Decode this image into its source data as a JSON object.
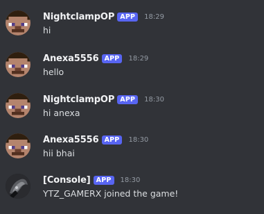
{
  "colors": {
    "background": "#313338",
    "app_badge": "#5865f2",
    "author": "#f2f3f5",
    "text": "#dbdee1",
    "timestamp": "#949ba4"
  },
  "messages": [
    {
      "author": "NightclampOP",
      "badge": "APP",
      "time": "18:29",
      "text": "hi",
      "avatar": "steve-avatar"
    },
    {
      "author": "Anexa5556",
      "badge": "APP",
      "time": "18:29",
      "text": "hello",
      "avatar": "steve-avatar"
    },
    {
      "author": "NightclampOP",
      "badge": "APP",
      "time": "18:30",
      "text": "hi anexa",
      "avatar": "steve-avatar"
    },
    {
      "author": "Anexa5556",
      "badge": "APP",
      "time": "18:30",
      "text": "hii bhai",
      "avatar": "steve-avatar"
    },
    {
      "author": "[Console]",
      "badge": "APP",
      "time": "18:30",
      "text": "YTZ_GAMERX joined the game!",
      "avatar": "console-avatar"
    }
  ]
}
